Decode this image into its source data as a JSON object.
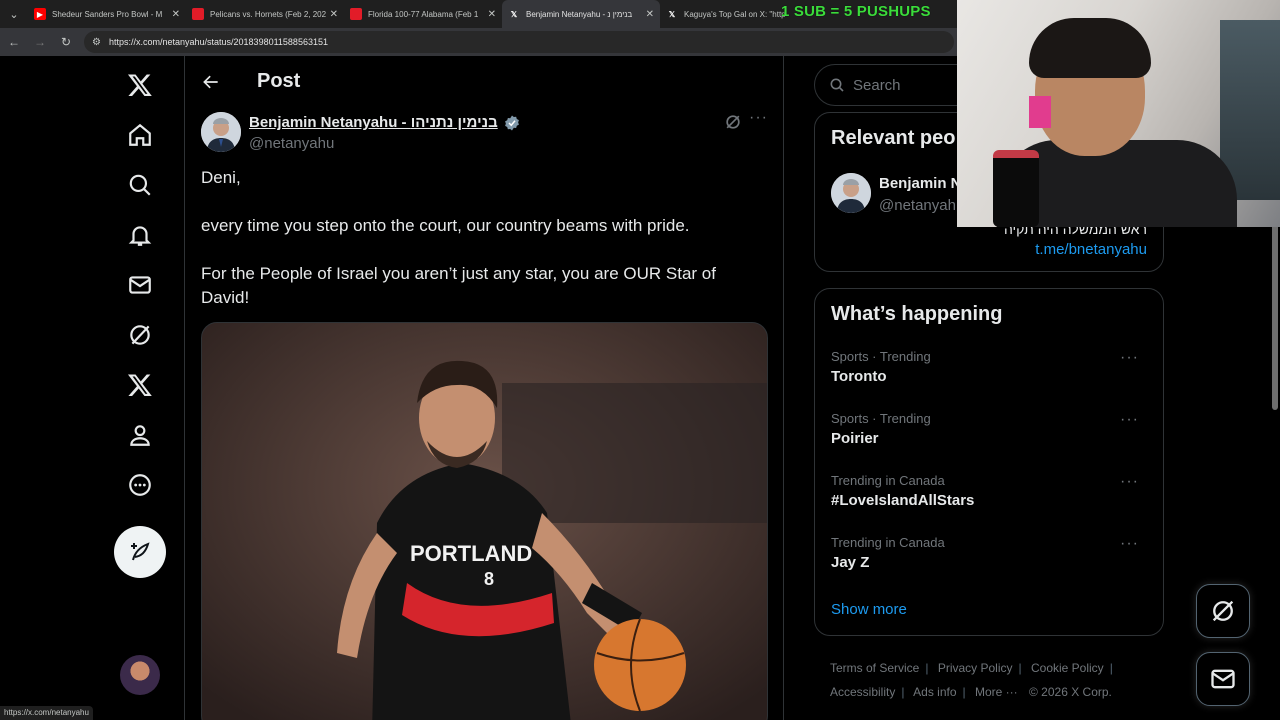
{
  "browser": {
    "tabs": [
      {
        "title": "Shedeur Sanders Pro Bowl - M",
        "favicon_color": "#ff0000",
        "active": false
      },
      {
        "title": "Pelicans vs. Hornets (Feb 2, 202",
        "favicon_color": "#e21c28",
        "active": false
      },
      {
        "title": "Florida 100-77 Alabama (Feb 1",
        "favicon_color": "#e21c28",
        "active": false
      },
      {
        "title": "Benjamin Netanyahu - בנימין נ",
        "favicon_color": "#ffffff",
        "active": true
      },
      {
        "title": "Kaguya's Top Gal on X: \"http",
        "favicon_color": "#ffffff",
        "active": false
      }
    ],
    "url": "https://x.com/netanyahu/status/2018398011588563151",
    "status_url": "https://x.com/netanyahu"
  },
  "nav": {
    "items": [
      "x-logo",
      "home",
      "explore",
      "notifications",
      "messages",
      "grok",
      "premium",
      "profile",
      "more"
    ]
  },
  "main": {
    "header_title": "Post",
    "author_name": "Benjamin Netanyahu - בנימין נתניהו",
    "author_handle": "@netanyahu",
    "text": [
      "Deni,",
      "every time you step onto the court, our country beams with pride.",
      "For the People of Israel you aren’t just any star, you are OUR Star of David!"
    ],
    "media": {
      "jersey_team": "PORTLAND",
      "jersey_number": "8"
    }
  },
  "sidebar": {
    "search_placeholder": "Search",
    "relevant_title": "Relevant peo",
    "relevant_name": "Benjamin N",
    "relevant_handle": "@netanyah",
    "relevant_bio": "ראש הממשלה היה תקיה",
    "relevant_link": "t.me/bnetanyahu",
    "happening_title": "What’s happening",
    "trends": [
      {
        "meta": "Sports · Trending",
        "name": "Toronto"
      },
      {
        "meta": "Sports · Trending",
        "name": "Poirier"
      },
      {
        "meta": "Trending in Canada",
        "name": "#LoveIslandAllStars"
      },
      {
        "meta": "Trending in Canada",
        "name": "Jay Z"
      }
    ],
    "show_more": "Show more"
  },
  "footer": {
    "links": [
      "Terms of Service",
      "Privacy Policy",
      "Cookie Policy",
      "Accessibility",
      "Ads info",
      "More ···"
    ],
    "copyright": "© 2026 X Corp."
  },
  "overlay": {
    "banner": "1 SUB = 5 PUSHUPS"
  },
  "colors": {
    "accent": "#1d9bf0",
    "banner_green": "#3bdc3b",
    "verified": "#829aab"
  }
}
